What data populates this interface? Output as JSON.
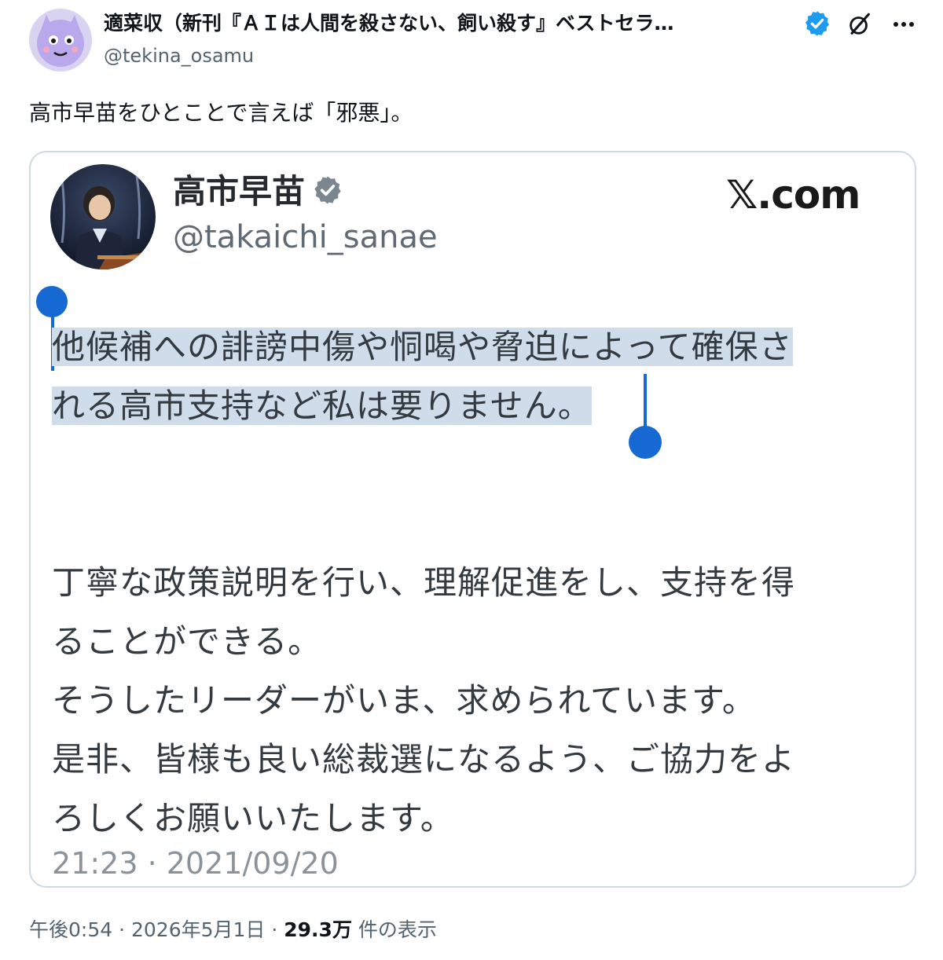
{
  "post": {
    "author_name": "適菜収（新刊『ＡＩは人間を殺さない、飼い殺す』ベストセラ…",
    "author_handle": "@tekina_osamu",
    "text": "高市早苗をひとことで言えば「邪悪」。",
    "timestamp": "午後0:54 · 2026年5月1日 · ",
    "views_count": "29.3万",
    "views_label": " 件の表示",
    "icons": [
      "avatar",
      "verified-badge-icon",
      "grok-icon",
      "more-icon"
    ]
  },
  "quoted": {
    "name": "高市早苗",
    "handle": "@takaichi_sanae",
    "source": "𝕏.com",
    "selected_lines": [
      "他候補への誹謗中傷や恫喝や脅迫によって確保さ",
      "れる高市支持など私は要りません。"
    ],
    "lines": [
      "丁寧な政策説明を行い、理解促進をし、支持を得",
      "ることができる。",
      "そうしたリーダーがいま、求められています。",
      "是非、皆様も良い総裁選になるよう、ご協力をよ",
      "ろしくお願いいたします。"
    ],
    "time": "21:23 · 2021/09/20"
  },
  "colors": {
    "verified_blue": "#1d9bf0",
    "selection": "#cfdcea",
    "selection_handle": "#1668d2",
    "muted": "#536471"
  }
}
